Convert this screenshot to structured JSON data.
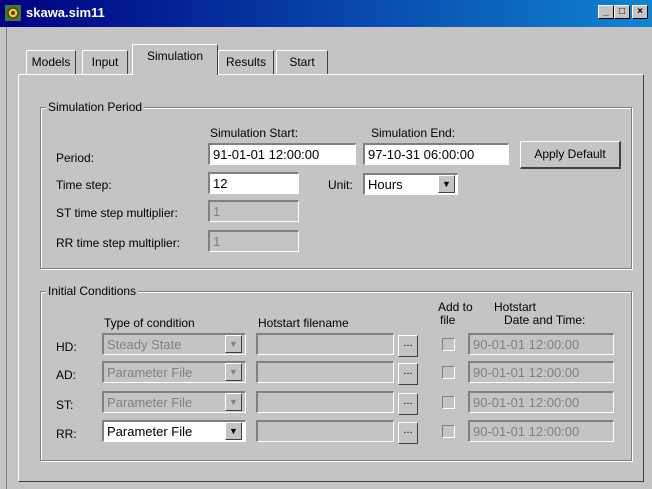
{
  "window": {
    "title": "skawa.sim11",
    "icon": "app-gear-icon",
    "title_bar_color": "#000080"
  },
  "tabs": [
    {
      "label": "Models"
    },
    {
      "label": "Input"
    },
    {
      "label": "Simulation",
      "active": true
    },
    {
      "label": "Results"
    },
    {
      "label": "Start"
    }
  ],
  "simulation_period": {
    "legend": "Simulation Period",
    "start_header": "Simulation Start:",
    "end_header": "Simulation End:",
    "period_label": "Period:",
    "start_value": "91-01-01 12:00:00",
    "end_value": "97-10-31 06:00:00",
    "apply_default": "Apply Default",
    "time_step_label": "Time step:",
    "time_step_value": "12",
    "unit_label": "Unit:",
    "unit_value": "Hours",
    "st_mult_label": "ST time step multiplier:",
    "st_mult_value": "1",
    "rr_mult_label": "RR time step multiplier:",
    "rr_mult_value": "1"
  },
  "initial_conditions": {
    "legend": "Initial Conditions",
    "col_type": "Type of condition",
    "col_hotstart_file": "Hotstart filename",
    "col_add_top": "Add to",
    "col_add_bottom": "file",
    "col_hot_top": "Hotstart",
    "col_hot_bottom": "Date and Time:",
    "browse": "...",
    "rows": [
      {
        "label": "HD:",
        "type": "Steady State",
        "datetime": "90-01-01 12:00:00"
      },
      {
        "label": "AD:",
        "type": "Parameter File",
        "datetime": "90-01-01 12:00:00"
      },
      {
        "label": "ST:",
        "type": "Parameter File",
        "datetime": "90-01-01 12:00:00"
      },
      {
        "label": "RR:",
        "type": "Parameter File",
        "datetime": "90-01-01 12:00:00"
      }
    ]
  }
}
